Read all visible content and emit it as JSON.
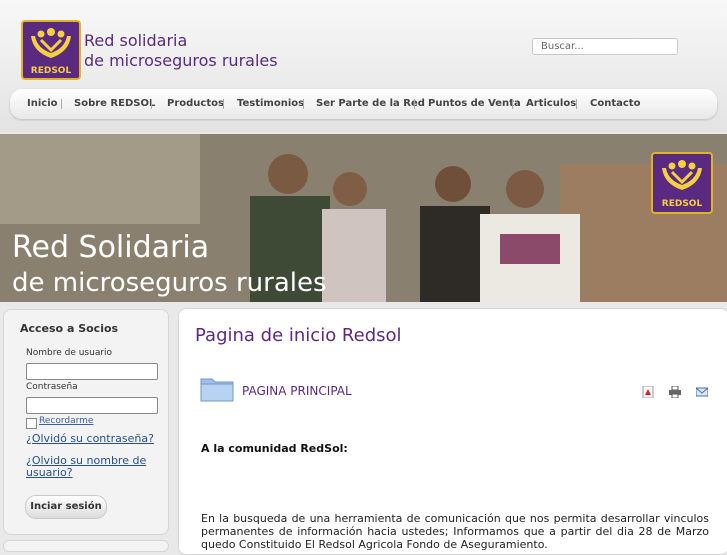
{
  "brand": {
    "line1": "Red solidaria",
    "line2": "de microseguros rurales",
    "logo_text": "REDSOL"
  },
  "search": {
    "placeholder": "Buscar..."
  },
  "nav": {
    "items": [
      {
        "label": "Inicio"
      },
      {
        "label": "Sobre REDSOL"
      },
      {
        "label": "Productos"
      },
      {
        "label": "Testimonios"
      },
      {
        "label": "Ser Parte de la Red"
      },
      {
        "label": "Puntos de Venta"
      },
      {
        "label": "Articulos"
      },
      {
        "label": "Contacto"
      }
    ]
  },
  "banner": {
    "title_line1": "Red Solidaria",
    "title_line2": "de microseguros rurales",
    "logo_text": "REDSOL"
  },
  "login": {
    "title": "Acceso a Socios",
    "username_label": "Nombre de usuario",
    "password_label": "Contraseña",
    "remember_label": "Recordarme",
    "forgot_password": "¿Olvidó su contraseña?",
    "forgot_username": "¿Olvido su nombre de usuario?",
    "submit_label": "Inciar sesión"
  },
  "main": {
    "page_title": "Pagina de inicio Redsol",
    "section_title": "PAGINA PRINCIPAL",
    "greeting": "A la comunidad RedSol:",
    "paragraph": "En la busqueda de una herramienta de comunicación que nos permita desarrollar vinculos permanentes de información hacia ustedes;  Informamos que a partir del dia 28 de Marzo quedo Constituido El Redsol Agricola Fondo de Aseguramiento."
  },
  "colors": {
    "brand_purple": "#5a2a80",
    "brand_gold": "#e0b320",
    "link_blue": "#274f8d"
  },
  "icons": [
    "pdf-icon",
    "print-icon",
    "email-icon",
    "folder-icon"
  ]
}
